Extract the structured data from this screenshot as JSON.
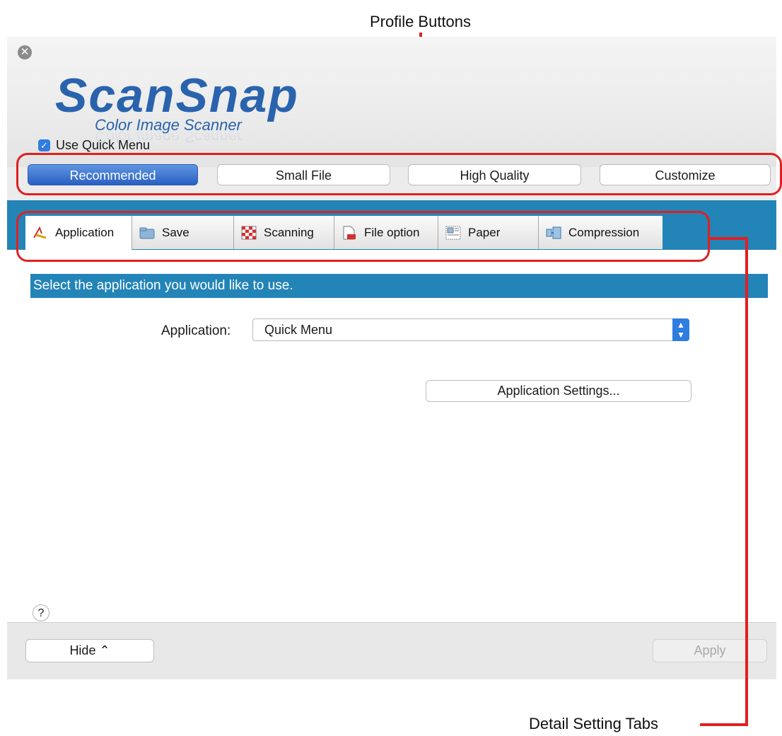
{
  "annotations": {
    "profile_buttons": "Profile Buttons",
    "detail_setting_tabs": "Detail Setting Tabs"
  },
  "logo": {
    "brand": "ScanSnap",
    "tagline": "Color Image Scanner"
  },
  "quick_menu": {
    "label": "Use Quick Menu",
    "checked": true
  },
  "profiles": [
    {
      "label": "Recommended",
      "active": true
    },
    {
      "label": "Small File",
      "active": false
    },
    {
      "label": "High Quality",
      "active": false
    },
    {
      "label": "Customize",
      "active": false
    }
  ],
  "tabs": [
    {
      "label": "Application",
      "icon": "application-icon",
      "active": true
    },
    {
      "label": "Save",
      "icon": "folder-icon"
    },
    {
      "label": "Scanning",
      "icon": "scanning-icon"
    },
    {
      "label": "File option",
      "icon": "file-option-icon"
    },
    {
      "label": "Paper",
      "icon": "paper-icon"
    },
    {
      "label": "Compression",
      "icon": "compression-icon"
    }
  ],
  "application_tab": {
    "instruction": "Select the application you would like to use.",
    "application_label": "Application:",
    "application_value": "Quick Menu",
    "settings_button": "Application Settings..."
  },
  "help": "?",
  "footer": {
    "hide_label": "Hide ⌃",
    "apply_label": "Apply"
  },
  "colors": {
    "accent": "#2384b7",
    "selected_blue": "#2f7de1",
    "annotation_red": "#e02020"
  }
}
